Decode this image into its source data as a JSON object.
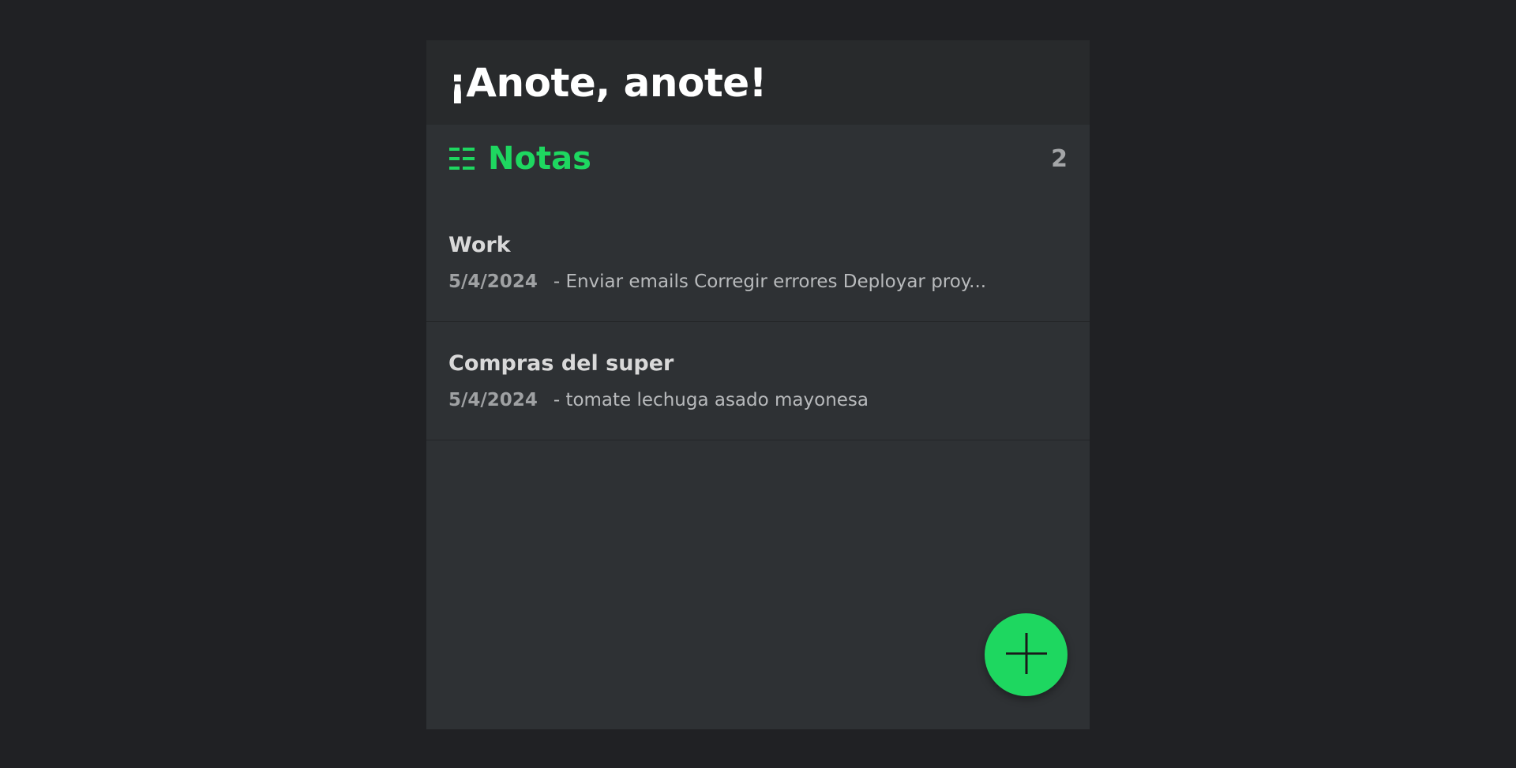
{
  "app": {
    "title": "¡Anote, anote!"
  },
  "section": {
    "icon": "list-icon",
    "title": "Notas",
    "count": "2"
  },
  "notes": [
    {
      "title": "Work",
      "date": "5/4/2024",
      "preview": "- Enviar emails Corregir errores Deployar proy..."
    },
    {
      "title": "Compras del super",
      "date": "5/4/2024",
      "preview": "- tomate lechuga asado mayonesa"
    }
  ],
  "fab": {
    "icon": "plus-icon"
  },
  "colors": {
    "accent": "#1ed760",
    "background": "#202124",
    "panel": "#2e3134",
    "header": "#282a2c"
  }
}
